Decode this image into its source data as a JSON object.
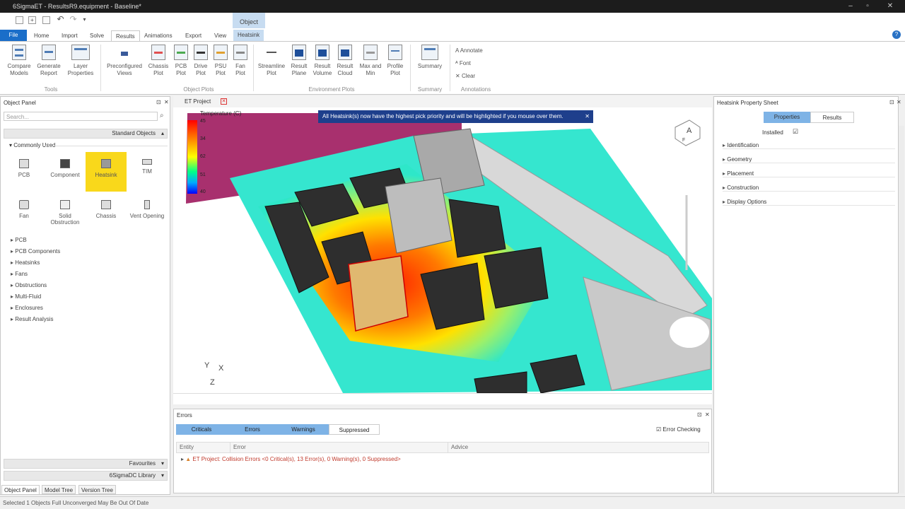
{
  "window": {
    "title": "6SigmaET - ResultsR9.equipment - Baseline*"
  },
  "tabs": {
    "file": "File",
    "home": "Home",
    "import": "Import",
    "solve": "Solve",
    "results": "Results",
    "animations": "Animations",
    "export": "Export",
    "view": "View",
    "context_group": "Object",
    "context_tab": "Heatsink",
    "help": "?"
  },
  "ribbon": {
    "compare": "Compare Models",
    "generate": "Generate Report",
    "layer": "Layer Properties",
    "preconfigured": "Preconfigured Views",
    "chassis_plot": "Chassis Plot",
    "pcb_plot": "PCB Plot",
    "drive_plot": "Drive Plot",
    "psu_plot": "PSU Plot",
    "fan_plot": "Fan Plot",
    "streamline": "Streamline Plot",
    "result_plane": "Result Plane",
    "result_volume": "Result Volume",
    "result_cloud": "Result Cloud",
    "max_min": "Max and Min",
    "profile_plot": "Profile Plot",
    "summary": "Summary",
    "annotate": "Annotate",
    "font": "Font",
    "clear": "Clear",
    "group_tools": "Tools",
    "group_object_plots": "Object Plots",
    "group_environment_plots": "Environment Plots",
    "group_summary": "Summary",
    "group_annotations": "Annotations"
  },
  "object_panel": {
    "title": "Object Panel",
    "search_placeholder": "Search...",
    "standard_objects": "Standard Objects",
    "commonly_used": "Commonly Used",
    "tiles": [
      "PCB",
      "Component",
      "Heatsink",
      "TIM",
      "Fan",
      "Solid Obstruction",
      "Chassis",
      "Vent Opening"
    ],
    "tree": [
      "PCB",
      "PCB Components",
      "Heatsinks",
      "Fans",
      "Obstructions",
      "Multi-Fluid",
      "Enclosures",
      "Result Analysis"
    ],
    "favourites": "Favourites",
    "library": "6SigmaDC Library",
    "bottom_tabs": [
      "Object Panel",
      "Model Tree",
      "Version Tree"
    ]
  },
  "viewport": {
    "tab_label": "ET Project",
    "notice": "All Heatsink(s) now have the highest pick priority and will be highlighted if you mouse over them.",
    "legend_title": "Temperature (C)",
    "legend_ticks": [
      "45",
      "34",
      "62",
      "51",
      "40"
    ],
    "axis_x": "X",
    "axis_y": "Y",
    "axis_z": "Z",
    "cube_top": "A",
    "cube_front": "F"
  },
  "errors": {
    "title": "Errors",
    "filters": [
      "Criticals",
      "Errors",
      "Warnings",
      "Suppressed"
    ],
    "error_checking": "Error Checking",
    "columns": [
      "Entity",
      "Error",
      "Advice"
    ],
    "row": "ET Project: Collision Errors <0 Critical(s), 13 Error(s), 0 Warning(s), 0 Suppressed>"
  },
  "property_sheet": {
    "title": "Heatsink Property Sheet",
    "tab_properties": "Properties",
    "tab_results": "Results",
    "installed": "Installed",
    "groups": [
      "Identification",
      "Geometry",
      "Placement",
      "Construction",
      "Display Options"
    ]
  },
  "status": {
    "text": "Selected 1 Objects  Full Unconverged May Be Out Of Date"
  },
  "colors": {
    "accent": "#1a6ec9",
    "selected_tile": "#f9d81b",
    "notice_bg": "#1e3f8c",
    "error_text": "#c0392b"
  }
}
